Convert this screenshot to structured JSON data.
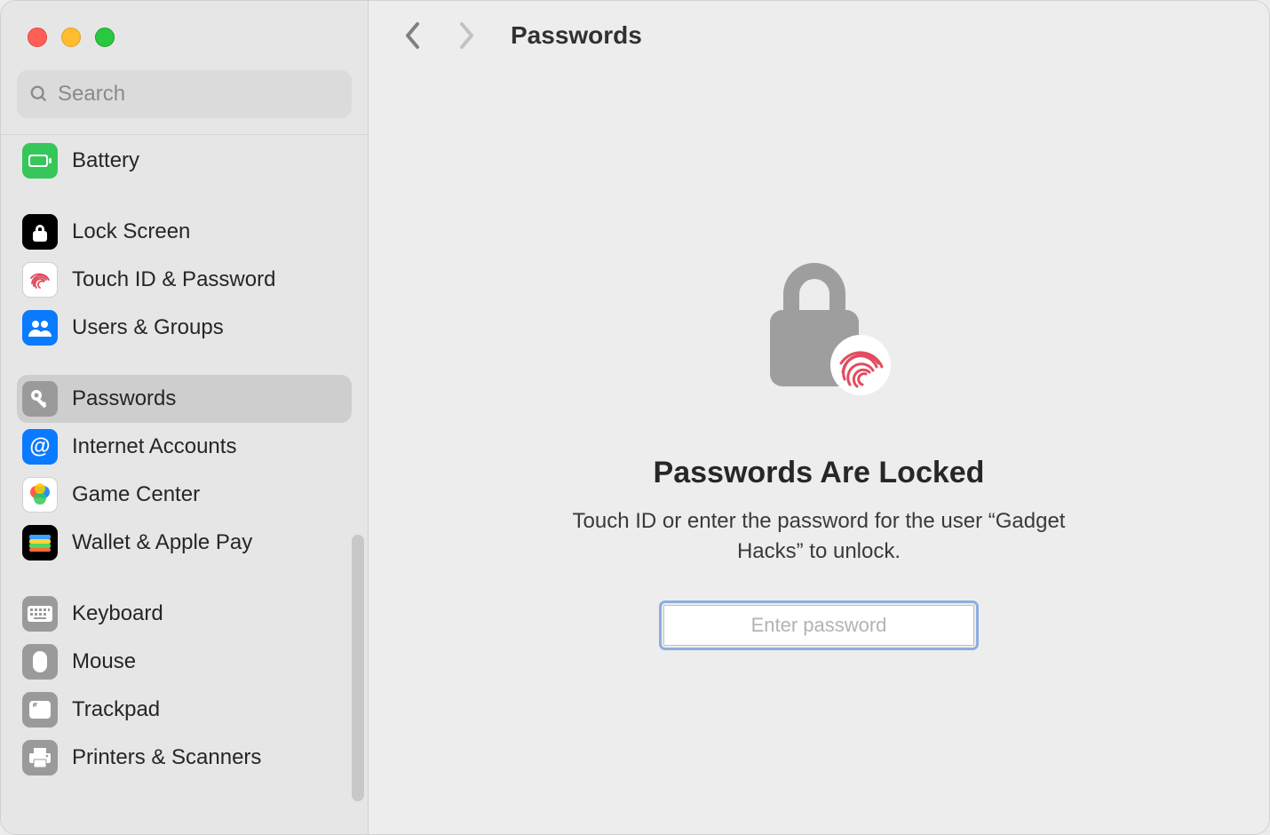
{
  "window": {
    "title": "Passwords"
  },
  "search": {
    "placeholder": "Search",
    "value": ""
  },
  "sidebar": {
    "items": [
      {
        "id": "battery",
        "label": "Battery",
        "icon": "battery-icon",
        "bg": "#35c759",
        "selected": false,
        "group_start": false
      },
      {
        "id": "lock-screen",
        "label": "Lock Screen",
        "icon": "lock-icon",
        "bg": "#000000",
        "selected": false,
        "group_start": true
      },
      {
        "id": "touch-id",
        "label": "Touch ID & Password",
        "icon": "fingerprint-icon",
        "bg": "#ffffff",
        "selected": false,
        "group_start": false
      },
      {
        "id": "users-groups",
        "label": "Users & Groups",
        "icon": "users-icon",
        "bg": "#0a7aff",
        "selected": false,
        "group_start": false
      },
      {
        "id": "passwords",
        "label": "Passwords",
        "icon": "key-icon",
        "bg": "#9a9a9a",
        "selected": true,
        "group_start": true
      },
      {
        "id": "internet-accounts",
        "label": "Internet Accounts",
        "icon": "at-icon",
        "bg": "#0a7aff",
        "selected": false,
        "group_start": false
      },
      {
        "id": "game-center",
        "label": "Game Center",
        "icon": "gamecenter-icon",
        "bg": "#ffffff",
        "selected": false,
        "group_start": false
      },
      {
        "id": "wallet",
        "label": "Wallet & Apple Pay",
        "icon": "wallet-icon",
        "bg": "#000000",
        "selected": false,
        "group_start": false
      },
      {
        "id": "keyboard",
        "label": "Keyboard",
        "icon": "keyboard-icon",
        "bg": "#9a9a9a",
        "selected": false,
        "group_start": true
      },
      {
        "id": "mouse",
        "label": "Mouse",
        "icon": "mouse-icon",
        "bg": "#9a9a9a",
        "selected": false,
        "group_start": false
      },
      {
        "id": "trackpad",
        "label": "Trackpad",
        "icon": "trackpad-icon",
        "bg": "#9a9a9a",
        "selected": false,
        "group_start": false
      },
      {
        "id": "printers",
        "label": "Printers & Scanners",
        "icon": "printer-icon",
        "bg": "#9a9a9a",
        "selected": false,
        "group_start": false
      }
    ]
  },
  "main": {
    "locked_title": "Passwords Are Locked",
    "locked_subtitle": "Touch ID or enter the password for the user “Gadget Hacks” to unlock.",
    "password_placeholder": "Enter password",
    "password_value": ""
  }
}
